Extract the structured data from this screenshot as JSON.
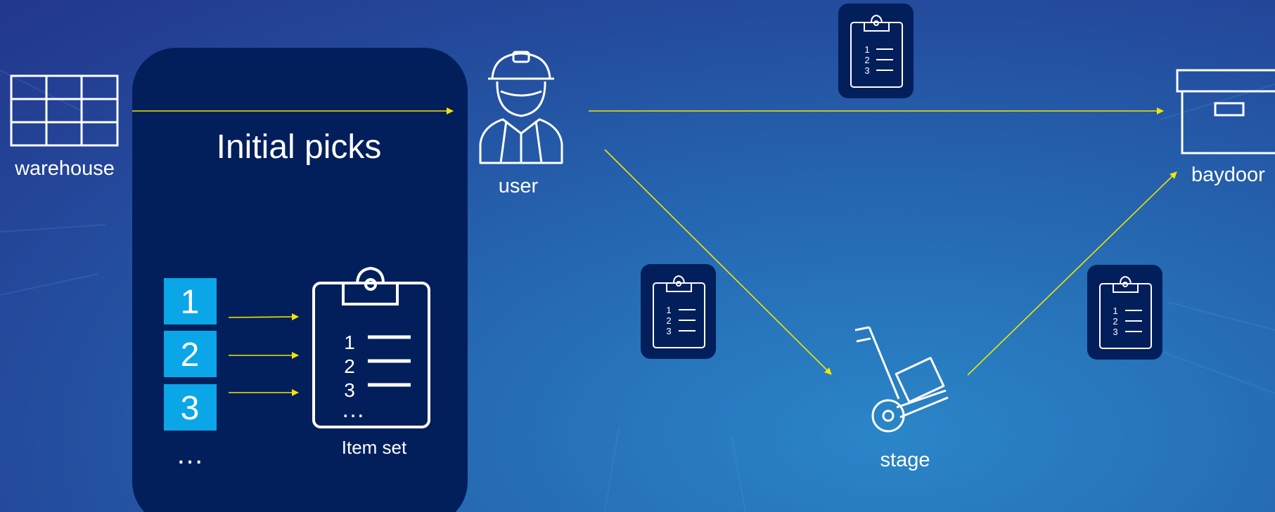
{
  "nodes": {
    "warehouse": {
      "label": "warehouse",
      "icon": "warehouse-grid-icon"
    },
    "user": {
      "label": "user",
      "icon": "worker-icon"
    },
    "stage": {
      "label": "stage",
      "icon": "hand-truck-icon"
    },
    "baydoor": {
      "label": "baydoor",
      "icon": "box-icon"
    }
  },
  "panel": {
    "title": "Initial picks",
    "items": [
      "1",
      "2",
      "3"
    ],
    "items_more": "…",
    "clipboard": {
      "numbers": [
        "1",
        "2",
        "3"
      ],
      "more": "…",
      "label": "Item set"
    }
  },
  "mini_clipboards": [
    {
      "numbers": [
        "1",
        "2",
        "3"
      ]
    },
    {
      "numbers": [
        "1",
        "2",
        "3"
      ]
    },
    {
      "numbers": [
        "1",
        "2",
        "3"
      ]
    }
  ],
  "colors": {
    "arrow": "#f3e600",
    "panel": "#021f5c",
    "item_box": "#0aa6e8",
    "icon_stroke": "#ffffff"
  }
}
